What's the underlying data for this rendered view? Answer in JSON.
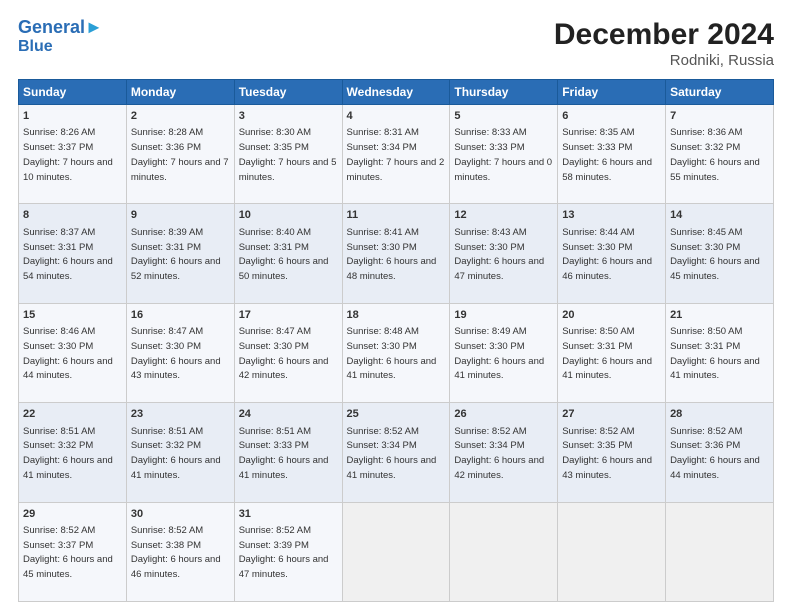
{
  "header": {
    "logo_main": "General",
    "logo_sub": "Blue",
    "title": "December 2024",
    "subtitle": "Rodniki, Russia"
  },
  "days_of_week": [
    "Sunday",
    "Monday",
    "Tuesday",
    "Wednesday",
    "Thursday",
    "Friday",
    "Saturday"
  ],
  "weeks": [
    [
      {
        "day": "1",
        "sunrise": "Sunrise: 8:26 AM",
        "sunset": "Sunset: 3:37 PM",
        "daylight": "Daylight: 7 hours and 10 minutes."
      },
      {
        "day": "2",
        "sunrise": "Sunrise: 8:28 AM",
        "sunset": "Sunset: 3:36 PM",
        "daylight": "Daylight: 7 hours and 7 minutes."
      },
      {
        "day": "3",
        "sunrise": "Sunrise: 8:30 AM",
        "sunset": "Sunset: 3:35 PM",
        "daylight": "Daylight: 7 hours and 5 minutes."
      },
      {
        "day": "4",
        "sunrise": "Sunrise: 8:31 AM",
        "sunset": "Sunset: 3:34 PM",
        "daylight": "Daylight: 7 hours and 2 minutes."
      },
      {
        "day": "5",
        "sunrise": "Sunrise: 8:33 AM",
        "sunset": "Sunset: 3:33 PM",
        "daylight": "Daylight: 7 hours and 0 minutes."
      },
      {
        "day": "6",
        "sunrise": "Sunrise: 8:35 AM",
        "sunset": "Sunset: 3:33 PM",
        "daylight": "Daylight: 6 hours and 58 minutes."
      },
      {
        "day": "7",
        "sunrise": "Sunrise: 8:36 AM",
        "sunset": "Sunset: 3:32 PM",
        "daylight": "Daylight: 6 hours and 55 minutes."
      }
    ],
    [
      {
        "day": "8",
        "sunrise": "Sunrise: 8:37 AM",
        "sunset": "Sunset: 3:31 PM",
        "daylight": "Daylight: 6 hours and 54 minutes."
      },
      {
        "day": "9",
        "sunrise": "Sunrise: 8:39 AM",
        "sunset": "Sunset: 3:31 PM",
        "daylight": "Daylight: 6 hours and 52 minutes."
      },
      {
        "day": "10",
        "sunrise": "Sunrise: 8:40 AM",
        "sunset": "Sunset: 3:31 PM",
        "daylight": "Daylight: 6 hours and 50 minutes."
      },
      {
        "day": "11",
        "sunrise": "Sunrise: 8:41 AM",
        "sunset": "Sunset: 3:30 PM",
        "daylight": "Daylight: 6 hours and 48 minutes."
      },
      {
        "day": "12",
        "sunrise": "Sunrise: 8:43 AM",
        "sunset": "Sunset: 3:30 PM",
        "daylight": "Daylight: 6 hours and 47 minutes."
      },
      {
        "day": "13",
        "sunrise": "Sunrise: 8:44 AM",
        "sunset": "Sunset: 3:30 PM",
        "daylight": "Daylight: 6 hours and 46 minutes."
      },
      {
        "day": "14",
        "sunrise": "Sunrise: 8:45 AM",
        "sunset": "Sunset: 3:30 PM",
        "daylight": "Daylight: 6 hours and 45 minutes."
      }
    ],
    [
      {
        "day": "15",
        "sunrise": "Sunrise: 8:46 AM",
        "sunset": "Sunset: 3:30 PM",
        "daylight": "Daylight: 6 hours and 44 minutes."
      },
      {
        "day": "16",
        "sunrise": "Sunrise: 8:47 AM",
        "sunset": "Sunset: 3:30 PM",
        "daylight": "Daylight: 6 hours and 43 minutes."
      },
      {
        "day": "17",
        "sunrise": "Sunrise: 8:47 AM",
        "sunset": "Sunset: 3:30 PM",
        "daylight": "Daylight: 6 hours and 42 minutes."
      },
      {
        "day": "18",
        "sunrise": "Sunrise: 8:48 AM",
        "sunset": "Sunset: 3:30 PM",
        "daylight": "Daylight: 6 hours and 41 minutes."
      },
      {
        "day": "19",
        "sunrise": "Sunrise: 8:49 AM",
        "sunset": "Sunset: 3:30 PM",
        "daylight": "Daylight: 6 hours and 41 minutes."
      },
      {
        "day": "20",
        "sunrise": "Sunrise: 8:50 AM",
        "sunset": "Sunset: 3:31 PM",
        "daylight": "Daylight: 6 hours and 41 minutes."
      },
      {
        "day": "21",
        "sunrise": "Sunrise: 8:50 AM",
        "sunset": "Sunset: 3:31 PM",
        "daylight": "Daylight: 6 hours and 41 minutes."
      }
    ],
    [
      {
        "day": "22",
        "sunrise": "Sunrise: 8:51 AM",
        "sunset": "Sunset: 3:32 PM",
        "daylight": "Daylight: 6 hours and 41 minutes."
      },
      {
        "day": "23",
        "sunrise": "Sunrise: 8:51 AM",
        "sunset": "Sunset: 3:32 PM",
        "daylight": "Daylight: 6 hours and 41 minutes."
      },
      {
        "day": "24",
        "sunrise": "Sunrise: 8:51 AM",
        "sunset": "Sunset: 3:33 PM",
        "daylight": "Daylight: 6 hours and 41 minutes."
      },
      {
        "day": "25",
        "sunrise": "Sunrise: 8:52 AM",
        "sunset": "Sunset: 3:34 PM",
        "daylight": "Daylight: 6 hours and 41 minutes."
      },
      {
        "day": "26",
        "sunrise": "Sunrise: 8:52 AM",
        "sunset": "Sunset: 3:34 PM",
        "daylight": "Daylight: 6 hours and 42 minutes."
      },
      {
        "day": "27",
        "sunrise": "Sunrise: 8:52 AM",
        "sunset": "Sunset: 3:35 PM",
        "daylight": "Daylight: 6 hours and 43 minutes."
      },
      {
        "day": "28",
        "sunrise": "Sunrise: 8:52 AM",
        "sunset": "Sunset: 3:36 PM",
        "daylight": "Daylight: 6 hours and 44 minutes."
      }
    ],
    [
      {
        "day": "29",
        "sunrise": "Sunrise: 8:52 AM",
        "sunset": "Sunset: 3:37 PM",
        "daylight": "Daylight: 6 hours and 45 minutes."
      },
      {
        "day": "30",
        "sunrise": "Sunrise: 8:52 AM",
        "sunset": "Sunset: 3:38 PM",
        "daylight": "Daylight: 6 hours and 46 minutes."
      },
      {
        "day": "31",
        "sunrise": "Sunrise: 8:52 AM",
        "sunset": "Sunset: 3:39 PM",
        "daylight": "Daylight: 6 hours and 47 minutes."
      },
      null,
      null,
      null,
      null
    ]
  ]
}
